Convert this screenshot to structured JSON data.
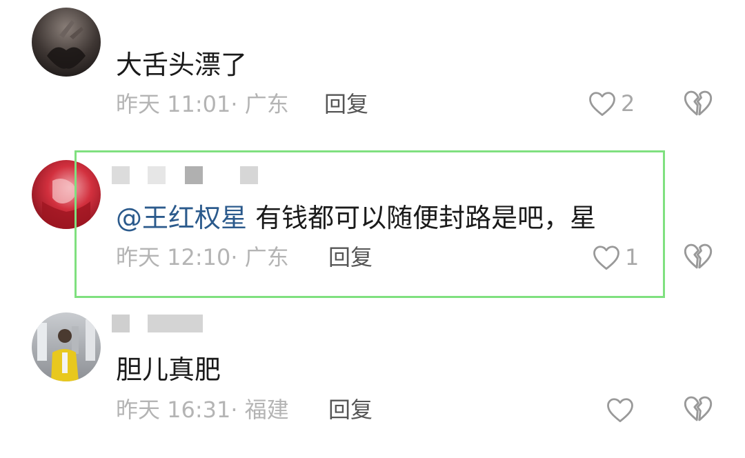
{
  "comments": [
    {
      "text": "大舌头漂了",
      "meta": "昨天 11:01· 广东",
      "reply_label": "回复",
      "like_count": "2"
    },
    {
      "mention": "@王红权星",
      "text": " 有钱都可以随便封路是吧，星",
      "meta": "昨天 12:10· 广东",
      "reply_label": "回复",
      "like_count": "1"
    },
    {
      "text": "胆儿真肥",
      "meta": "昨天 16:31· 福建",
      "reply_label": "回复",
      "like_count": ""
    }
  ],
  "colors": {
    "highlight_border": "#7fe07f",
    "mention": "#2b5a8c",
    "meta_text": "#b4b4b4"
  },
  "icons": {
    "like": "heart-outline-icon",
    "dislike": "broken-heart-icon"
  }
}
